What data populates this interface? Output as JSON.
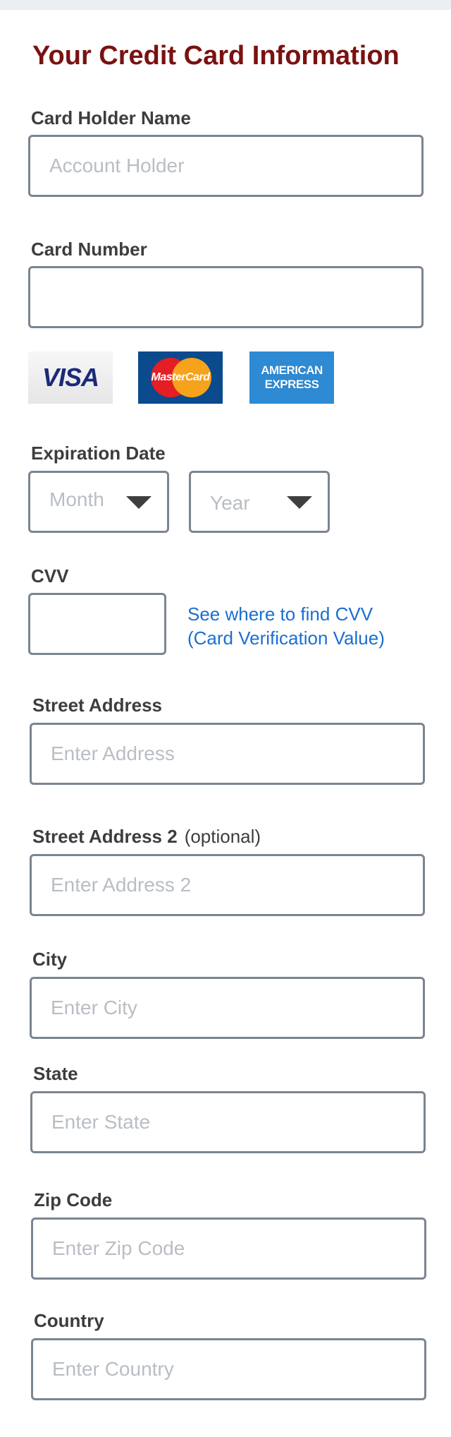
{
  "page": {
    "title": "Your Credit Card Information"
  },
  "card_holder": {
    "label": "Card Holder Name",
    "placeholder": "Account Holder",
    "value": ""
  },
  "card_number": {
    "label": "Card Number",
    "placeholder": "",
    "value": ""
  },
  "card_logos": {
    "visa": "VISA",
    "mastercard": "MasterCard",
    "amex_line1": "AMERICAN",
    "amex_line2": "EXPRESS"
  },
  "expiration": {
    "label": "Expiration Date",
    "month_value": "Month",
    "year_value": "Year"
  },
  "cvv": {
    "label": "CVV",
    "value": "",
    "help_line1": "See where to find CVV",
    "help_line2": "(Card Verification Value)"
  },
  "street": {
    "label": "Street Address",
    "placeholder": "Enter Address"
  },
  "street2": {
    "label": "Street Address 2",
    "optional": "(optional)",
    "placeholder": "Enter Address 2"
  },
  "city": {
    "label": "City",
    "placeholder": "Enter City"
  },
  "state": {
    "label": "State",
    "placeholder": "Enter State"
  },
  "zip": {
    "label": "Zip Code",
    "placeholder": "Enter Zip Code"
  },
  "country": {
    "label": "Country",
    "placeholder": "Enter Country"
  },
  "colors": {
    "title": "#7a1111",
    "link": "#1a6fd1",
    "border": "#7b8590",
    "placeholder": "#b9bec4"
  }
}
